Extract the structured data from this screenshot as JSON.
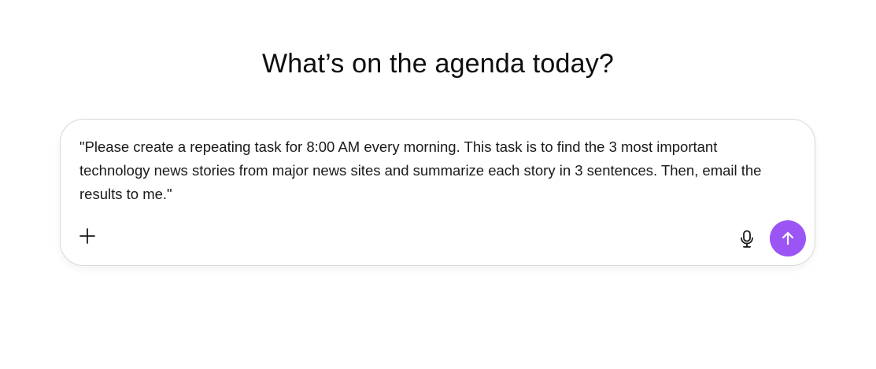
{
  "heading": "What’s on the agenda today?",
  "composer": {
    "prompt_text": "\"Please create a repeating task for 8:00 AM every morning. This task is to find the 3 most important technology news stories from major news sites and summarize each story in 3 sentences. Then, email the results to me.\"",
    "add_icon": "plus-icon",
    "mic_icon": "microphone-icon",
    "send_icon": "arrow-up-icon"
  },
  "colors": {
    "send_button": "#9b55f5",
    "border": "#d9d9d9",
    "text": "#0d0d0d"
  }
}
